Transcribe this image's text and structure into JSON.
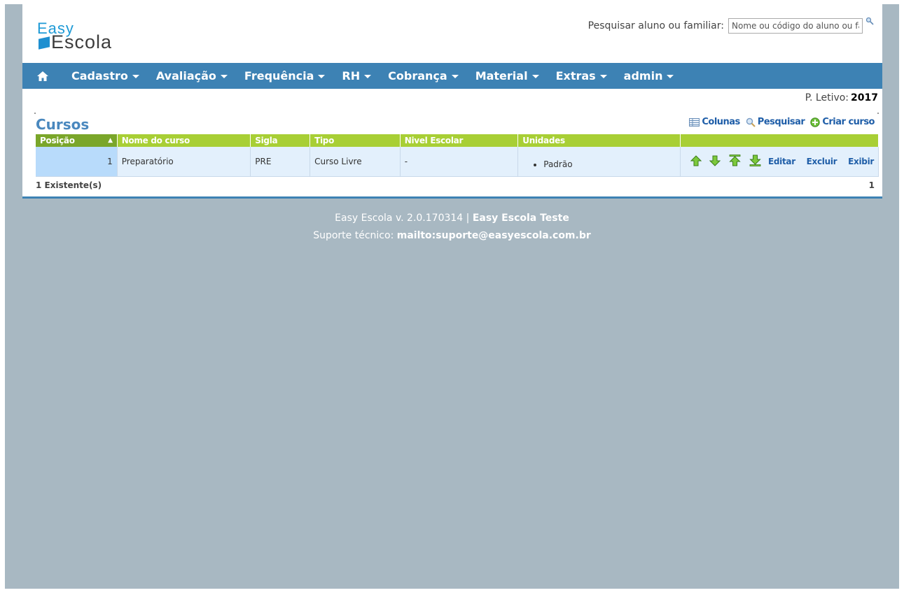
{
  "header": {
    "logo_top": "Easy",
    "logo_bottom": "Escola",
    "search_label": "Pesquisar aluno ou familiar:",
    "search_placeholder": "Nome ou código do aluno ou familiar",
    "search_icon": "magnifier-icon"
  },
  "nav": {
    "home_icon": "home-icon",
    "items": [
      {
        "label": "Cadastro"
      },
      {
        "label": "Avaliação"
      },
      {
        "label": "Frequência"
      },
      {
        "label": "RH"
      },
      {
        "label": "Cobrança"
      },
      {
        "label": "Material"
      },
      {
        "label": "Extras"
      },
      {
        "label": "admin"
      }
    ],
    "color": "#3d82b4"
  },
  "period": {
    "label": "P. Letivo:",
    "value": "2017"
  },
  "page": {
    "title": "Cursos",
    "toolbar": {
      "columns": "Colunas",
      "search": "Pesquisar",
      "create": "Criar curso"
    }
  },
  "table": {
    "headers": {
      "position": "Posição",
      "name": "Nome do curso",
      "abbr": "Sigla",
      "type": "Tipo",
      "level": "Nivel Escolar",
      "units": "Unidades"
    },
    "rows": [
      {
        "position": "1",
        "name": "Preparatório",
        "abbr": "PRE",
        "type": "Curso Livre",
        "level": "-",
        "unit": "Padrão",
        "actions": {
          "edit": "Editar",
          "delete": "Excluir",
          "view": "Exibir"
        }
      }
    ],
    "count": "1 Existente(s)",
    "page": "1",
    "header_color": "#a8cf35"
  },
  "footer": {
    "version": "Easy Escola v. 2.0.170314 |",
    "school": "Easy Escola Teste",
    "support_label": "Suporte técnico:",
    "support_email": "mailto:suporte@easyescola.com.br"
  }
}
